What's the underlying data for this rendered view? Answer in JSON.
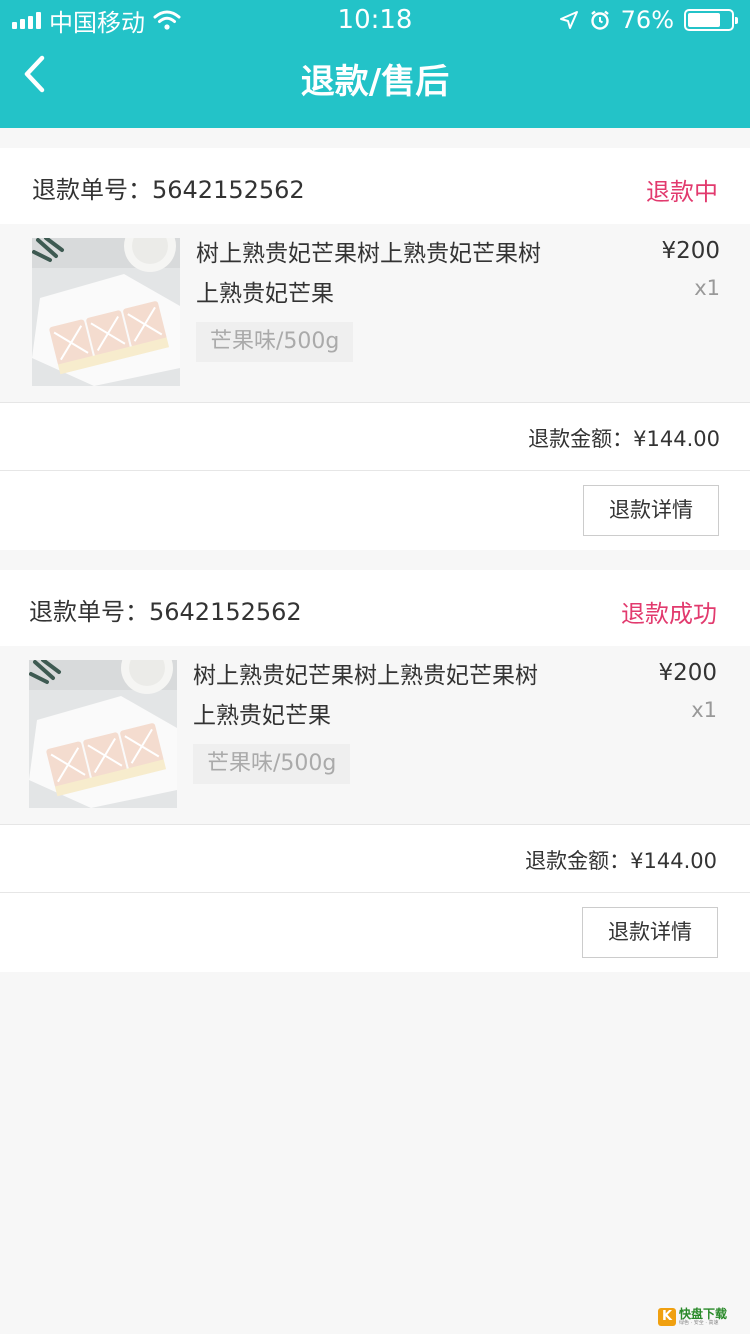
{
  "status_bar": {
    "carrier": "中国移动",
    "time": "10:18",
    "battery": "76%",
    "battery_level": 0.76
  },
  "nav": {
    "title": "退款/售后"
  },
  "orders": [
    {
      "order_label": "退款单号：",
      "order_number": "5642152562",
      "status": "退款中",
      "product_name": "树上熟贵妃芒果树上熟贵妃芒果树上熟贵妃芒果",
      "spec": "芒果味/500g",
      "price": "¥200",
      "qty": "x1",
      "amount_label": "退款金额：",
      "amount": "¥144.00",
      "detail_button": "退款详情"
    },
    {
      "order_label": "退款单号：",
      "order_number": "5642152562",
      "status": "退款成功",
      "product_name": "树上熟贵妃芒果树上熟贵妃芒果树上熟贵妃芒果",
      "spec": "芒果味/500g",
      "price": "¥200",
      "qty": "x1",
      "amount_label": "退款金额：",
      "amount": "¥144.00",
      "detail_button": "退款详情"
    }
  ],
  "watermark": {
    "logo_char": "K",
    "brand": "快盘下载",
    "tagline": "绿色 · 安全 · 高速"
  },
  "colors": {
    "header_bg": "#23c3c8",
    "status_accent": "#e23a6e",
    "page_bg": "#f7f7f7"
  },
  "icons": [
    "signal-icon",
    "wifi-icon",
    "back-arrow-icon",
    "location-icon",
    "alarm-icon",
    "battery-icon",
    "product-image"
  ]
}
